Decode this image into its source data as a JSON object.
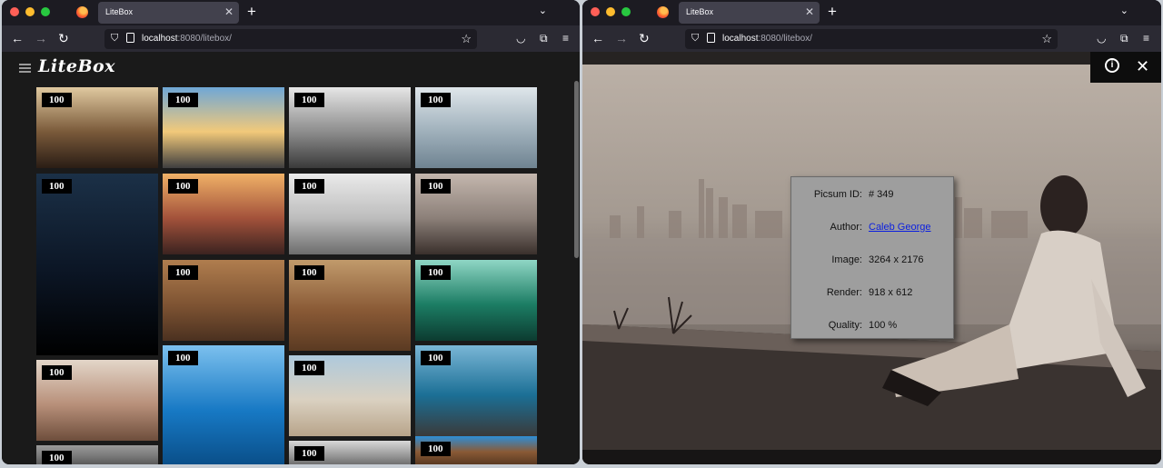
{
  "browser_left": {
    "tab_title": "LiteBox",
    "url_host": "localhost",
    "url_rest": ":8080/litebox/"
  },
  "browser_right": {
    "tab_title": "LiteBox",
    "url_host": "localhost",
    "url_rest": ":8080/litebox/"
  },
  "app": {
    "logo": "LiteBox",
    "menu_icon": "hamburger-icon"
  },
  "gallery": {
    "tiles": [
      {
        "badge": "100",
        "subject": "tunnel escalator",
        "colors": [
          "#e0c9a0",
          "#7a5a3a",
          "#2a1d15"
        ]
      },
      {
        "badge": "100",
        "subject": "road at sunset",
        "colors": [
          "#6fa7d6",
          "#f2c97a",
          "#3f3e3f"
        ]
      },
      {
        "badge": "100",
        "subject": "hills with fence",
        "colors": [
          "#e6e6e6",
          "#8d8d8d",
          "#3a3a3a"
        ]
      },
      {
        "badge": "100",
        "subject": "snowy forest",
        "colors": [
          "#dfe6ea",
          "#9fb0bb",
          "#6f8391"
        ]
      },
      {
        "badge": "100",
        "subject": "star trails",
        "colors": [
          "#1b3047",
          "#0b1524",
          "#000000"
        ]
      },
      {
        "badge": "100",
        "subject": "girl at sunset",
        "colors": [
          "#f0b167",
          "#a3523b",
          "#3b2320"
        ]
      },
      {
        "badge": "100",
        "subject": "man on beach",
        "colors": [
          "#eaeaea",
          "#bdbdbd",
          "#6d6d6d"
        ]
      },
      {
        "badge": "100",
        "subject": "man by the sea",
        "colors": [
          "#c4b7ae",
          "#8c8079",
          "#3a302c"
        ]
      },
      {
        "badge": "100",
        "subject": "laptop on desk",
        "colors": [
          "#b07d4e",
          "#7f5433",
          "#4b3120"
        ]
      },
      {
        "badge": "100",
        "subject": "desk items",
        "colors": [
          "#c19a6b",
          "#8a5a36",
          "#5a3a22"
        ]
      },
      {
        "badge": "100",
        "subject": "canoe on lake",
        "colors": [
          "#8fd6c5",
          "#1c7d64",
          "#0c3b30"
        ]
      },
      {
        "badge": "100",
        "subject": "laptop on table",
        "colors": [
          "#e3d6c9",
          "#b8907a",
          "#6e4e3c"
        ]
      },
      {
        "badge": "100",
        "subject": "blue sea",
        "colors": [
          "#7cc0ee",
          "#1779c4",
          "#0a4f8a"
        ]
      },
      {
        "badge": "100",
        "subject": "lifeguard tower",
        "colors": [
          "#aec9dc",
          "#dad1c1",
          "#b8a48a"
        ]
      },
      {
        "badge": "100",
        "subject": "rocky coast",
        "colors": [
          "#7ab6d6",
          "#1b6f95",
          "#3a3a3a"
        ]
      },
      {
        "badge": "100",
        "subject": "partial",
        "colors": [
          "#9a9a9a",
          "#7a7a7a",
          "#5a5a5a"
        ]
      },
      {
        "badge": "100",
        "subject": "partial",
        "colors": [
          "#d8d8d8",
          "#a0a0a0",
          "#707070"
        ]
      },
      {
        "badge": "100",
        "subject": "wooden wall",
        "colors": [
          "#2e8ed6",
          "#8a5a36",
          "#5a3a22"
        ]
      }
    ]
  },
  "lightbox": {
    "info_icon": "info-icon",
    "close_icon": "close-icon",
    "info": {
      "picsum_label": "Picsum ID:",
      "picsum_value": "# 349",
      "author_label": "Author:",
      "author_value": "Caleb George",
      "image_label": "Image:",
      "image_value": "3264 x 2176",
      "render_label": "Render:",
      "render_value": "918 x 612",
      "quality_label": "Quality:",
      "quality_value": "100 %"
    }
  }
}
